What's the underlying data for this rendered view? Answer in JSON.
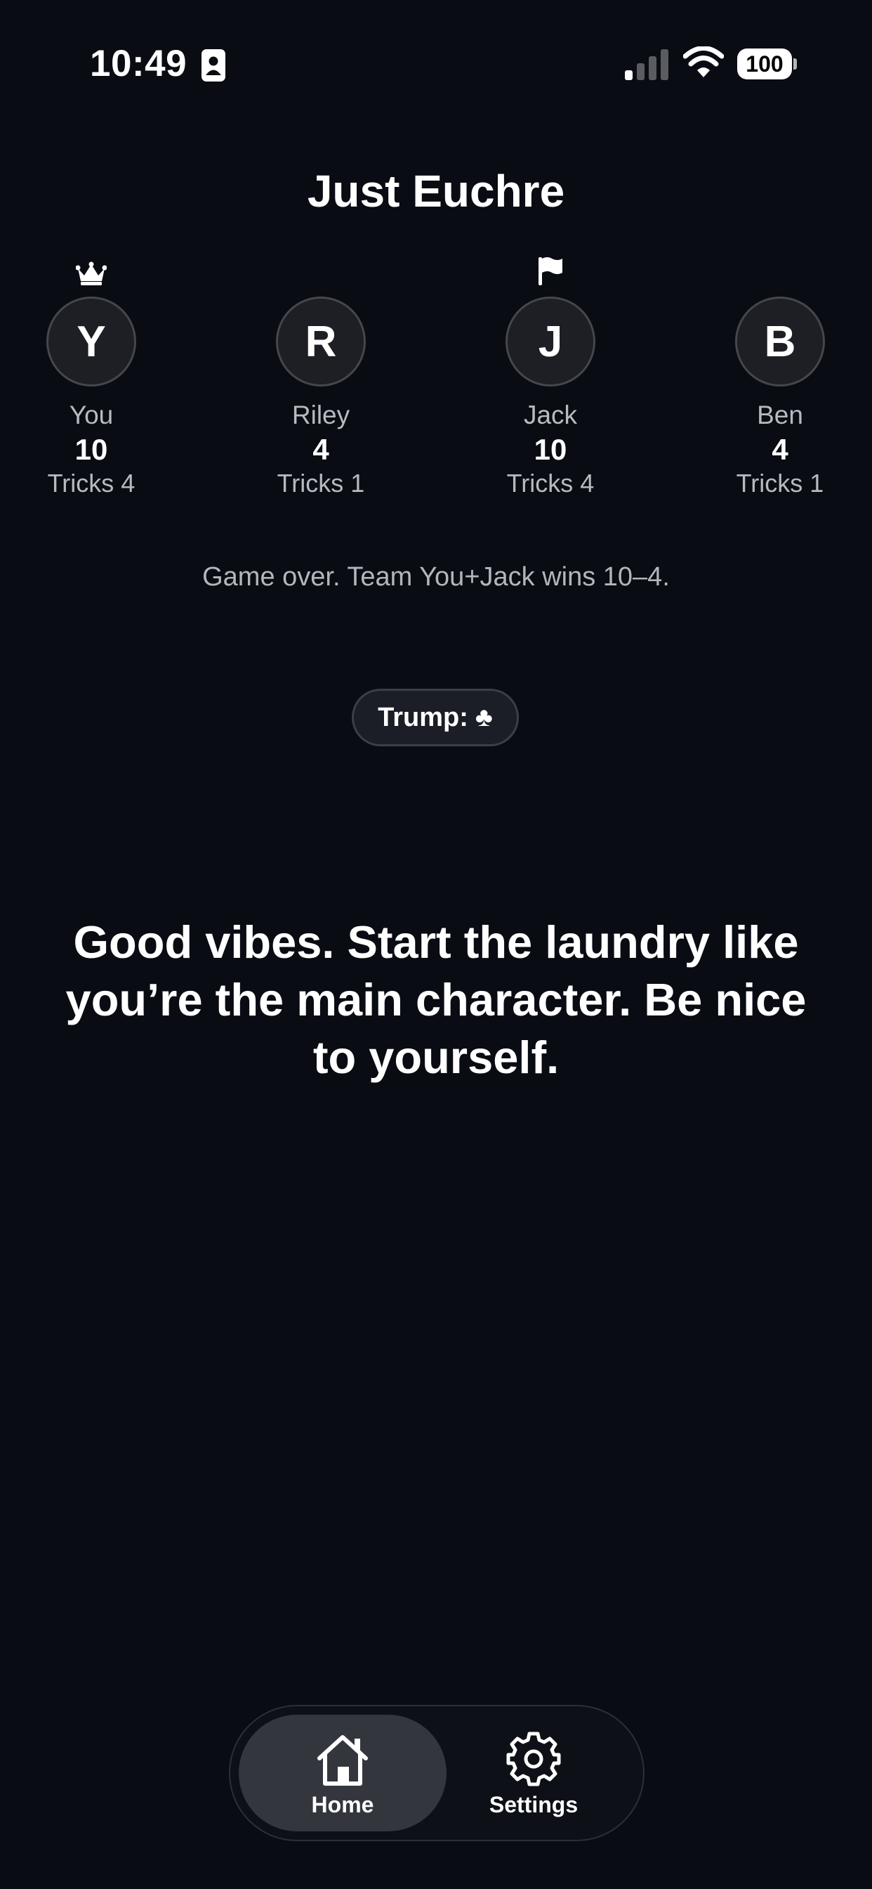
{
  "status_bar": {
    "time": "10:49",
    "battery": "100"
  },
  "app": {
    "title": "Just Euchre"
  },
  "players": [
    {
      "initial": "Y",
      "name": "You",
      "score": "10",
      "tricks": "Tricks 4",
      "marker": "crown-icon"
    },
    {
      "initial": "R",
      "name": "Riley",
      "score": "4",
      "tricks": "Tricks 1",
      "marker": ""
    },
    {
      "initial": "J",
      "name": "Jack",
      "score": "10",
      "tricks": "Tricks 4",
      "marker": "flag-icon"
    },
    {
      "initial": "B",
      "name": "Ben",
      "score": "4",
      "tricks": "Tricks 1",
      "marker": ""
    }
  ],
  "game": {
    "status_message": "Game over. Team You+Jack wins 10–4.",
    "trump_label": "Trump:",
    "trump_suit": "♣"
  },
  "quote": "Good vibes. Start the laundry like you’re the main character. Be nice to yourself.",
  "tab_bar": {
    "home_label": "Home",
    "settings_label": "Settings",
    "active": "home"
  },
  "colors": {
    "background": "#090c13",
    "avatar_fill": "#1e1f24",
    "active_tab": "#33363d",
    "muted_text": "#b8bac0"
  }
}
